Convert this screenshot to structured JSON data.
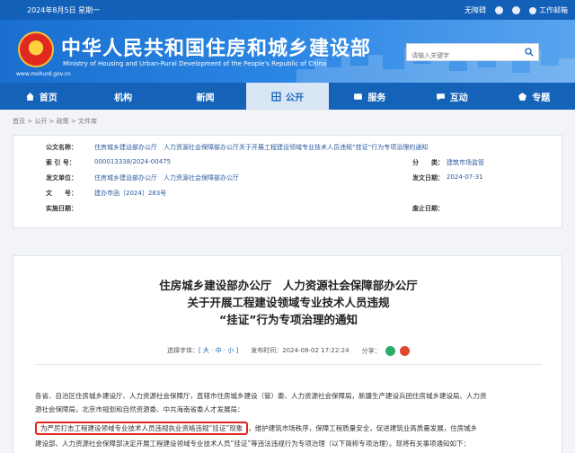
{
  "topbar": {
    "date": "2024年8月5日 星期一",
    "accessibility": "无障碍",
    "weibo_icon": "weibo-icon",
    "wechat_icon": "wechat-icon",
    "work_portal": "工作邮箱"
  },
  "header": {
    "title": "中华人民共和国住房和城乡建设部",
    "subtitle": "Ministry of Housing and Urban-Rural Development of the People's Republic of China",
    "domain": "www.mohurd.gov.cn",
    "search_placeholder": "请输入关键字"
  },
  "nav": [
    {
      "label": "首页",
      "icon": "home-icon"
    },
    {
      "label": "机构",
      "icon": "building-icon"
    },
    {
      "label": "新闻",
      "icon": "news-icon"
    },
    {
      "label": "公开",
      "icon": "public-icon"
    },
    {
      "label": "服务",
      "icon": "service-icon"
    },
    {
      "label": "互动",
      "icon": "chat-icon"
    },
    {
      "label": "专题",
      "icon": "topic-icon"
    }
  ],
  "breadcrumb": "首页 > 公开 > 政策 > 文件库",
  "info": {
    "publisher_label": "公文名称：",
    "publisher_value": "住房城乡建设部办公厅　人力资源社会保障部办公厅关于开展工程建设领域专业技术人员违规“挂证”行为专项治理的通知",
    "index_label": "索 引 号：",
    "index_value": "000013338/2024-00475",
    "category_label": "分　　类：",
    "category_value": "建筑市场监管",
    "org_label": "发文单位：",
    "org_value": "住房城乡建设部办公厅　人力资源社会保障部办公厅",
    "date_label": "发文日期：",
    "date_value": "2024-07-31",
    "docno_label": "文　　号：",
    "docno_value": "建办市函〔2024〕283号",
    "impl_label": "实施日期：",
    "impl_value": "",
    "abolish_label": "废止日期：",
    "abolish_value": ""
  },
  "document": {
    "title_line1": "住房城乡建设部办公厅　人力资源社会保障部办公厅",
    "title_line2": "关于开展工程建设领域专业技术人员违规",
    "title_line3": "“挂证”行为专项治理的通知",
    "font_size_label": "选择字体：",
    "font_size_options": "[ 大 · 中 · 小 ]",
    "publish_time": "发布时间：2024-08-02 17:22:24",
    "share_label": "分享：",
    "para1_line1": "各省、自治区住房城乡建设厅、人力资源社会保障厅，直辖市住房城乡建设（管）委、人力资源社会保障局，新疆生产建设兵团住房城乡建设局、人力资",
    "para1_line2": "源社会保障局，北京市规划和自然资源委、中共海南省委人才发展局：",
    "para2_highlight": "为严厉打击工程建设领域专业技术人员违规执业资格违规“挂证”现象",
    "para2_rest": "，维护建筑市场秩序，保障工程质量安全，促进建筑业高质量发展，住房城乡",
    "para2_line2": "建设部、人力资源社会保障部决定开展工程建设领域专业技术人员“挂证”等违法违规行为专项治理（以下简称专项治理）。现将有关事项通知如下："
  }
}
